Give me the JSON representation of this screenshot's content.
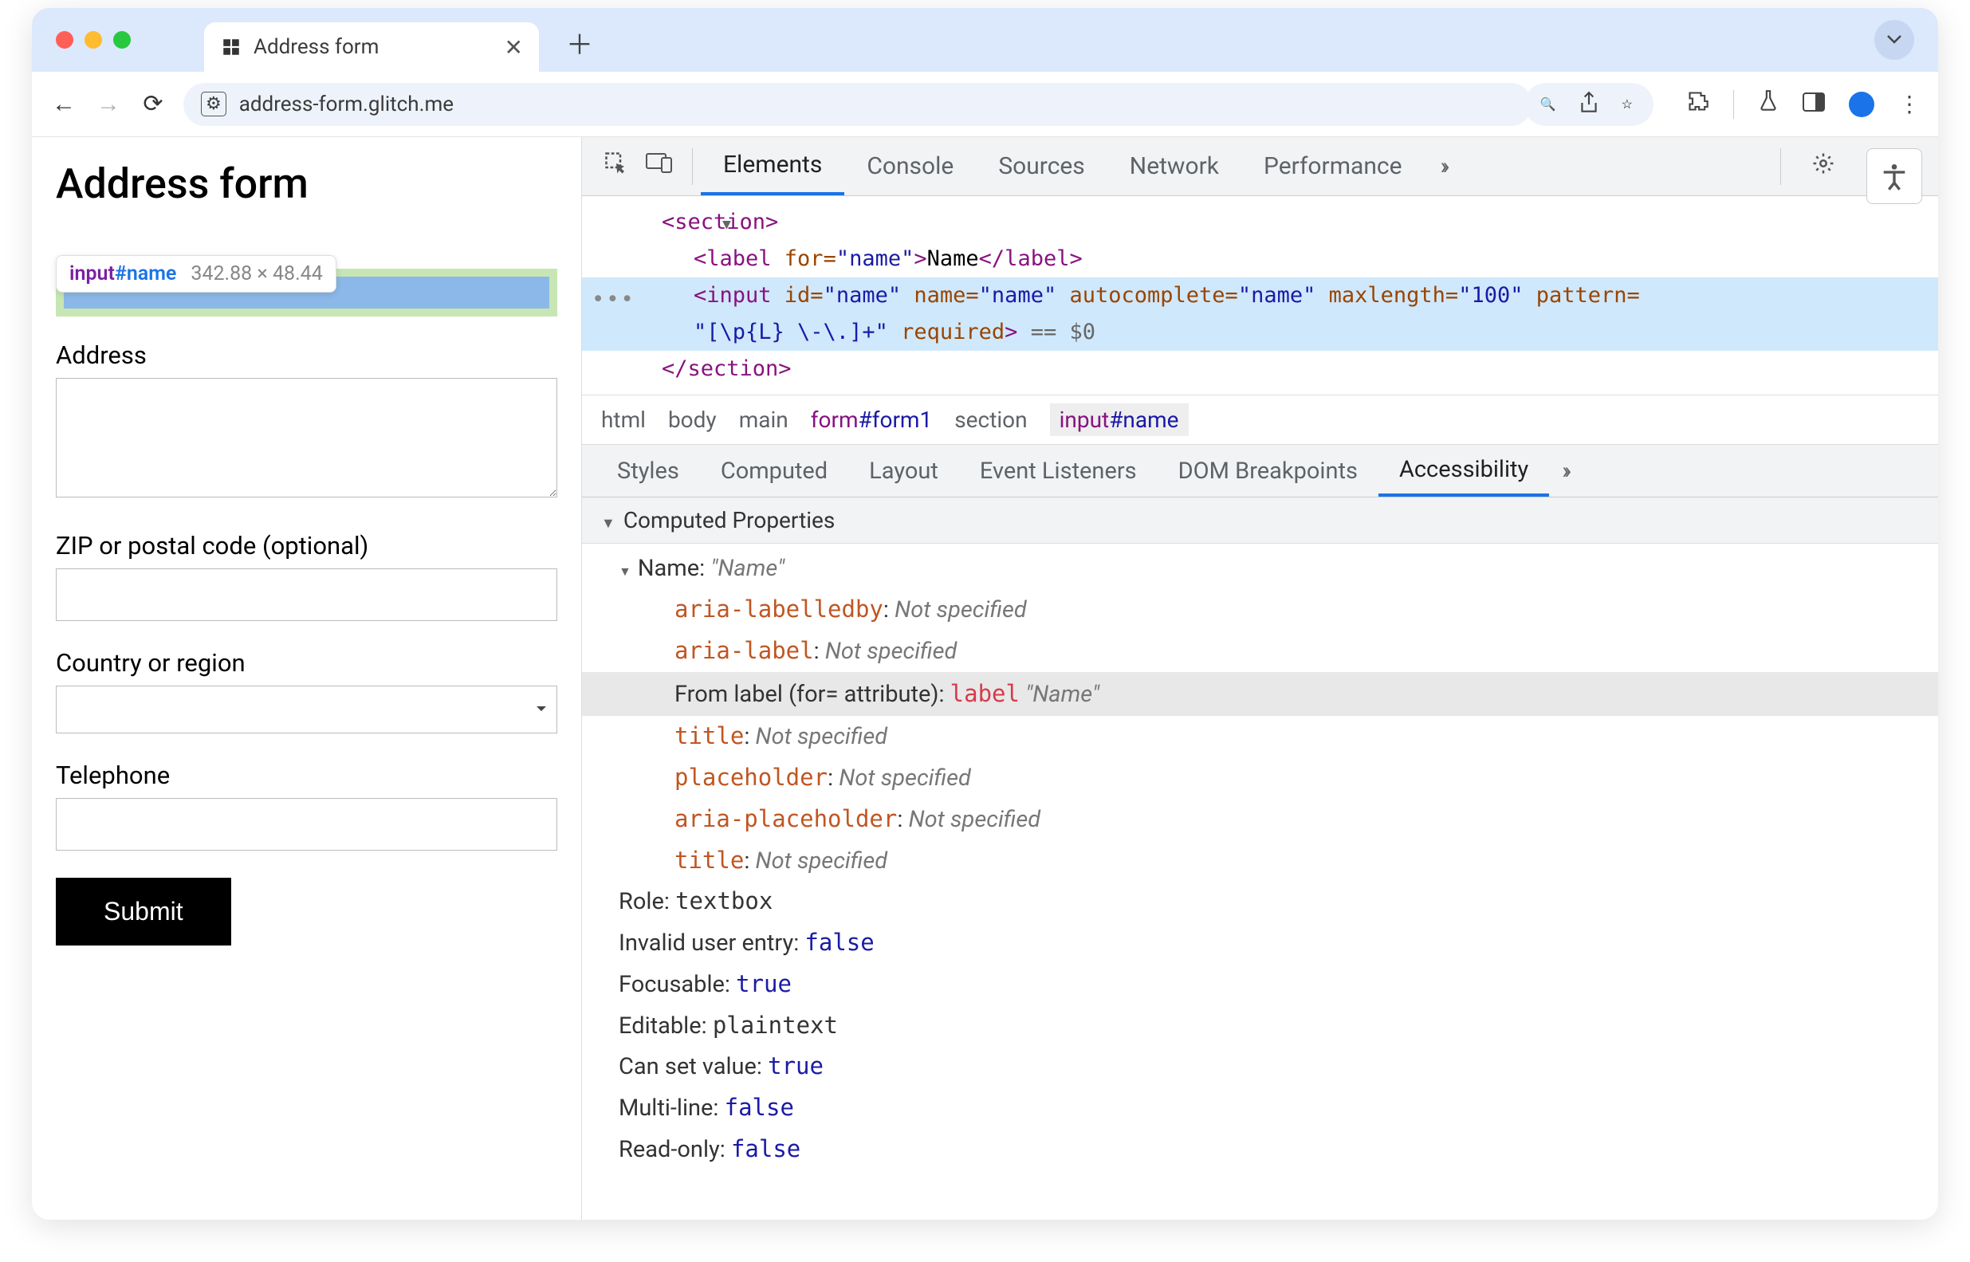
{
  "window": {
    "tab_title": "Address form",
    "url": "address-form.glitch.me"
  },
  "page": {
    "heading": "Address form",
    "inspect_tooltip": {
      "tag": "input",
      "id": "#name",
      "dims": "342.88 × 48.44"
    },
    "labels": {
      "address": "Address",
      "zip": "ZIP or postal code (optional)",
      "country": "Country or region",
      "telephone": "Telephone",
      "submit": "Submit"
    }
  },
  "devtools": {
    "tabs": [
      "Elements",
      "Console",
      "Sources",
      "Network",
      "Performance"
    ],
    "dom": {
      "section_open": "<section>",
      "label_line": {
        "open": "<label ",
        "attr": "for=",
        "val": "\"name\"",
        "close": ">",
        "text": "Name",
        "end": "</label>"
      },
      "input_line1": "<input id=\"name\" name=\"name\" autocomplete=\"name\" maxlength=\"100\" pattern=",
      "input_line2": "\"[\\p{L} \\-\\.]+\" required>",
      "input_after": "== $0",
      "section_close": "</section>"
    },
    "breadcrumb": [
      "html",
      "body",
      "main",
      "form#form1",
      "section",
      "input#name"
    ],
    "subtabs": [
      "Styles",
      "Computed",
      "Layout",
      "Event Listeners",
      "DOM Breakpoints",
      "Accessibility"
    ],
    "section_title": "Computed Properties",
    "a11y": {
      "name_label": "Name: ",
      "name_value": "\"Name\"",
      "sources": [
        {
          "key": "aria-labelledby",
          "val": "Not specified"
        },
        {
          "key": "aria-label",
          "val": "Not specified"
        }
      ],
      "from_label": {
        "prefix": "From label (for= attribute): ",
        "tag": "label",
        "val": "\"Name\""
      },
      "sources2": [
        {
          "key": "title",
          "val": "Not specified"
        },
        {
          "key": "placeholder",
          "val": "Not specified"
        },
        {
          "key": "aria-placeholder",
          "val": "Not specified"
        },
        {
          "key": "title",
          "val": "Not specified"
        }
      ],
      "props": [
        {
          "k": "Role: ",
          "v": "textbox",
          "mono": true
        },
        {
          "k": "Invalid user entry: ",
          "v": "false",
          "blue": true
        },
        {
          "k": "Focusable: ",
          "v": "true",
          "blue": true
        },
        {
          "k": "Editable: ",
          "v": "plaintext",
          "mono": true
        },
        {
          "k": "Can set value: ",
          "v": "true",
          "blue": true
        },
        {
          "k": "Multi-line: ",
          "v": "false",
          "blue": true
        },
        {
          "k": "Read-only: ",
          "v": "false",
          "blue": true
        }
      ]
    }
  }
}
